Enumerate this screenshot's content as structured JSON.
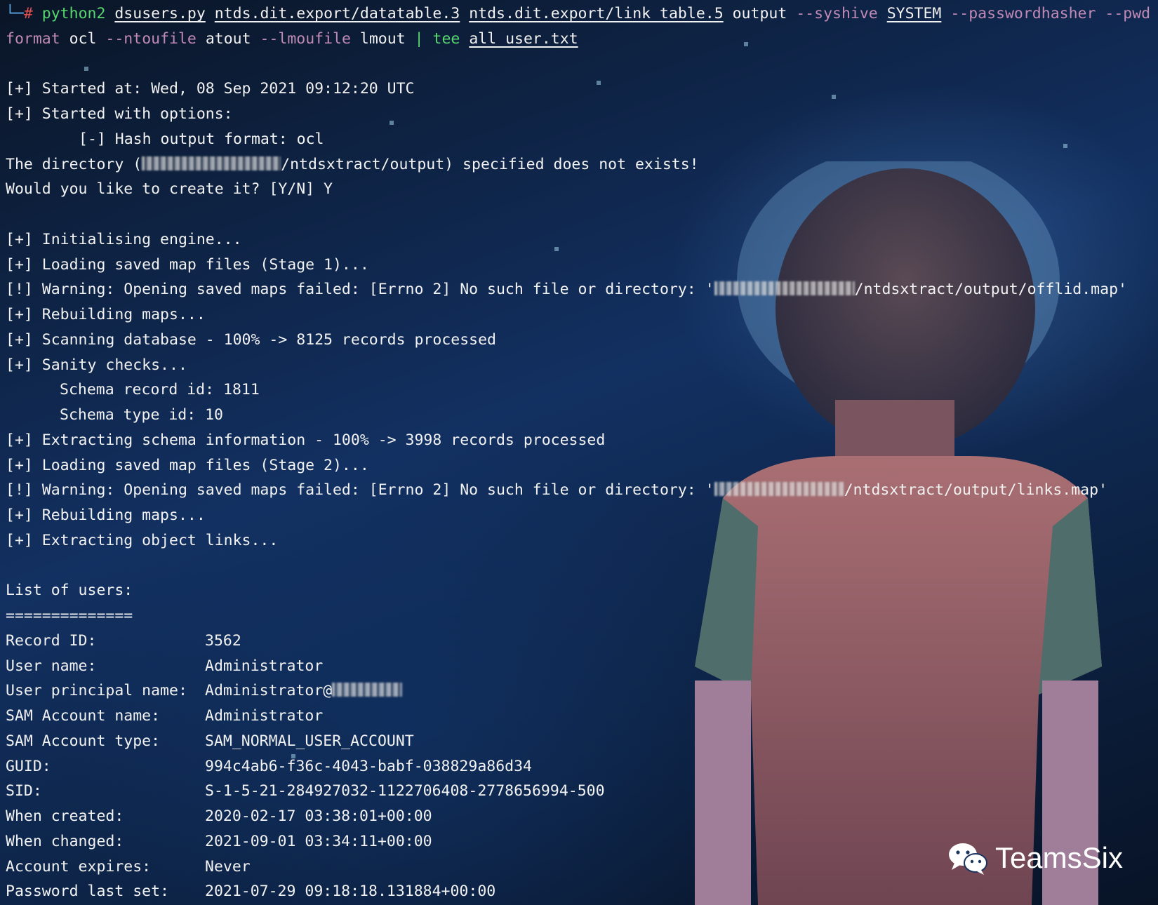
{
  "terminal": {
    "command": {
      "corner": "└─",
      "hash": "#",
      "python": "python2",
      "script": "dsusers.py",
      "datatable": "ntds.dit.export/datatable.3",
      "linktable": "ntds.dit.export/link_table.5",
      "output_word": "output",
      "syshive_flag": "--syshive",
      "syshive_val": "SYSTEM",
      "pwhasher_flag": "--passwordhasher",
      "pwd_flag_part1": "--pwd",
      "pwd_flag_part2": "format",
      "pwd_val": "ocl",
      "ntout_flag": "--ntoufile",
      "ntout_val": "atout",
      "lmout_flag": "--lmoufile",
      "lmout_val": "lmout",
      "pipe": "|",
      "tee": "tee",
      "tee_file": "all_user.txt"
    },
    "started_at": "[+] Started at: Wed, 08 Sep 2021 09:12:20 UTC",
    "started_options": "[+] Started with options:",
    "hash_format": "[-] Hash output format: ocl",
    "dir_prefix": "The directory (",
    "dir_suffix": "/ntdsxtract/output) specified does not exists!",
    "create_prompt": "Would you like to create it? [Y/N] Y",
    "init_engine": "[+] Initialising engine...",
    "loading_stage1": "[+] Loading saved map files (Stage 1)...",
    "warn1_prefix": "[!] Warning: Opening saved maps failed: [Errno 2] No such file or directory: '",
    "warn1_suffix": "/ntdsxtract/output/offlid.map'",
    "rebuilding1": "[+] Rebuilding maps...",
    "scanning": "[+] Scanning database - 100% -> 8125 records processed",
    "sanity": "[+] Sanity checks...",
    "schema_record": "Schema record id: 1811",
    "schema_type": "Schema type id: 10",
    "extracting_schema": "[+] Extracting schema information - 100% -> 3998 records processed",
    "loading_stage2": "[+] Loading saved map files (Stage 2)...",
    "warn2_prefix": "[!] Warning: Opening saved maps failed: [Errno 2] No such file or directory: '",
    "warn2_suffix": "/ntdsxtract/output/links.map'",
    "rebuilding2": "[+] Rebuilding maps...",
    "extracting_links": "[+] Extracting object links...",
    "list_title": "List of users:",
    "list_rule": "==============",
    "user": {
      "record_id_key": "Record ID:",
      "record_id_val": "3562",
      "user_name_key": "User name:",
      "user_name_val": "Administrator",
      "upn_key": "User principal name:",
      "upn_val": "Administrator@",
      "sam_name_key": "SAM Account name:",
      "sam_name_val": "Administrator",
      "sam_type_key": "SAM Account type:",
      "sam_type_val": "SAM_NORMAL_USER_ACCOUNT",
      "guid_key": "GUID:",
      "guid_val": "994c4ab6-f36c-4043-babf-038829a86d34",
      "sid_key": "SID:",
      "sid_val": "S-1-5-21-284927032-1122706408-2778656994-500",
      "created_key": "When created:",
      "created_val": "2020-02-17 03:38:01+00:00",
      "changed_key": "When changed:",
      "changed_val": "2021-09-01 03:34:11+00:00",
      "expires_key": "Account expires:",
      "expires_val": "Never",
      "pwd_last_key": "Password last set:",
      "pwd_last_val": "2021-07-29 09:18:18.131884+00:00"
    }
  },
  "watermark": {
    "icon": "wechat-icon",
    "text": "TeamsSix"
  },
  "colors": {
    "prompt_corner": "#5fa9e8",
    "prompt_hash": "#e05050",
    "command_green": "#56d66e",
    "flag": "#c08ab5",
    "text": "#f2f2f2"
  }
}
